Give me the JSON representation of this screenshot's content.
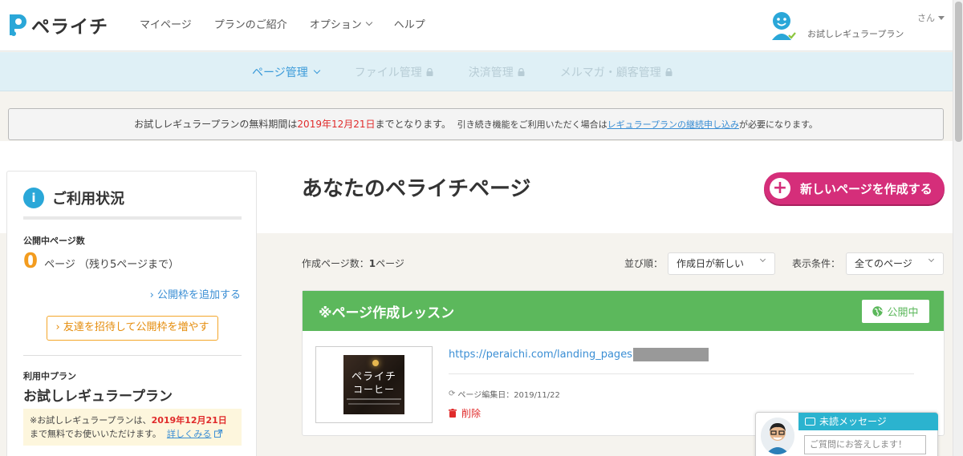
{
  "brand": {
    "name": "ペライチ",
    "accent": "#2aa7d8",
    "pink": "#d52e7a",
    "green": "#5cb85c",
    "orange": "#f39c1f"
  },
  "topnav": [
    {
      "label": "マイページ",
      "has_dropdown": false
    },
    {
      "label": "プランのご紹介",
      "has_dropdown": false
    },
    {
      "label": "オプション",
      "has_dropdown": true
    },
    {
      "label": "ヘルプ",
      "has_dropdown": false
    }
  ],
  "user": {
    "name_suffix": "さん",
    "plan": "お試しレギュラープラン",
    "avatar_icon": "user-avatar-icon"
  },
  "subnav": [
    {
      "label": "ページ管理",
      "active": true,
      "locked": false
    },
    {
      "label": "ファイル管理",
      "active": false,
      "locked": true
    },
    {
      "label": "決済管理",
      "active": false,
      "locked": true
    },
    {
      "label": "メルマガ・顧客管理",
      "active": false,
      "locked": true
    }
  ],
  "notice": {
    "part1": "お試しレギュラープランの無料期間は",
    "date": "2019年12月21日",
    "part2": "までとなります。",
    "part3": "引き続き機能をご利用いただく場合は",
    "link": "レギュラープランの継続申し込み",
    "part4": "が必要になります。"
  },
  "sidebar": {
    "title": "ご利用状況",
    "info_icon": "i",
    "published_label": "公開中ページ数",
    "published_count": "0",
    "published_unit": "ページ （残り5ページまで）",
    "add_link": "› 公開枠を追加する",
    "invite_button": "› 友達を招待して公開枠を増やす",
    "plan_label": "利用中プラン",
    "plan_name": "お試しレギュラープラン",
    "note_part1": "※お試しレギュラープランは、",
    "note_date": "2019年12月21日",
    "note_part2": "まで無料でお使いいただけます。",
    "note_link": "詳しくみる"
  },
  "main": {
    "title": "あなたのペライチページ",
    "new_button": "新しいページを作成する",
    "count_prefix": "作成ページ数：",
    "count_value": "1",
    "count_suffix": "ページ",
    "sort_label": "並び順：",
    "sort_value": "作成日が新しい",
    "filter_label": "表示条件：",
    "filter_value": "全てのページ"
  },
  "card": {
    "title": "※ページ作成レッスン",
    "status": "公開中",
    "thumb_line1": "ペライチ",
    "thumb_line2": "コーヒー",
    "url": "https://peraichi.com/landing_pages",
    "edited": "ページ編集日：2019/11/22",
    "delete": "削除"
  },
  "chat": {
    "header": "未読メッセージ",
    "placeholder": "ご質問にお答えします！"
  }
}
